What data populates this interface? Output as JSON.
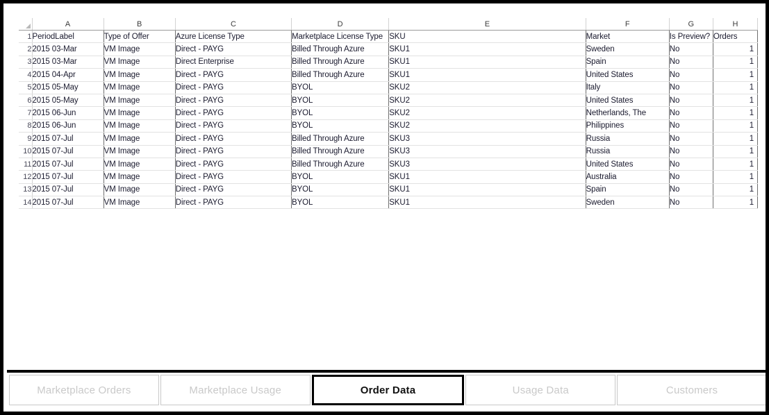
{
  "window": {
    "title": "Order Data"
  },
  "sheet": {
    "corner_label": "select-all",
    "column_letters": [
      "A",
      "B",
      "C",
      "D",
      "E",
      "F",
      "G",
      "H"
    ],
    "row_numbers": [
      "1",
      "2",
      "3",
      "4",
      "5",
      "6",
      "7",
      "8",
      "9",
      "10",
      "11",
      "12",
      "13",
      "14"
    ],
    "headers": {
      "a": "PeriodLabel",
      "b": "Type of Offer",
      "c": "Azure License Type",
      "d": "Marketplace License Type",
      "e": "SKU",
      "f": "Market",
      "g": "Is Preview?",
      "h": "Orders"
    },
    "rows": [
      {
        "num": "2",
        "period_label": "2015 03-Mar",
        "type_of_offer": "VM Image",
        "azure_license_type": "Direct - PAYG",
        "marketplace_license_type": "Billed Through Azure",
        "sku": "SKU1",
        "market": "Sweden",
        "is_preview": "No",
        "orders": "1"
      },
      {
        "num": "3",
        "period_label": "2015 03-Mar",
        "type_of_offer": "VM Image",
        "azure_license_type": "Direct Enterprise",
        "marketplace_license_type": "Billed Through Azure",
        "sku": "SKU1",
        "market": "Spain",
        "is_preview": "No",
        "orders": "1"
      },
      {
        "num": "4",
        "period_label": "2015 04-Apr",
        "type_of_offer": "VM Image",
        "azure_license_type": "Direct - PAYG",
        "marketplace_license_type": "Billed Through Azure",
        "sku": "SKU1",
        "market": "United States",
        "is_preview": "No",
        "orders": "1"
      },
      {
        "num": "5",
        "period_label": "2015 05-May",
        "type_of_offer": "VM Image",
        "azure_license_type": "Direct - PAYG",
        "marketplace_license_type": "BYOL",
        "sku": "SKU2",
        "market": "Italy",
        "is_preview": "No",
        "orders": "1"
      },
      {
        "num": "6",
        "period_label": "2015 05-May",
        "type_of_offer": "VM Image",
        "azure_license_type": "Direct - PAYG",
        "marketplace_license_type": "BYOL",
        "sku": "SKU2",
        "market": "United States",
        "is_preview": "No",
        "orders": "1"
      },
      {
        "num": "7",
        "period_label": "2015 06-Jun",
        "type_of_offer": "VM Image",
        "azure_license_type": "Direct - PAYG",
        "marketplace_license_type": "BYOL",
        "sku": "SKU2",
        "market": "Netherlands, The",
        "is_preview": "No",
        "orders": "1"
      },
      {
        "num": "8",
        "period_label": "2015 06-Jun",
        "type_of_offer": "VM Image",
        "azure_license_type": "Direct - PAYG",
        "marketplace_license_type": "BYOL",
        "sku": "SKU2",
        "market": "Philippines",
        "is_preview": "No",
        "orders": "1"
      },
      {
        "num": "9",
        "period_label": "2015 07-Jul",
        "type_of_offer": "VM Image",
        "azure_license_type": "Direct - PAYG",
        "marketplace_license_type": "Billed Through Azure",
        "sku": "SKU3",
        "market": "Russia",
        "is_preview": "No",
        "orders": "1"
      },
      {
        "num": "10",
        "period_label": "2015 07-Jul",
        "type_of_offer": "VM Image",
        "azure_license_type": "Direct - PAYG",
        "marketplace_license_type": "Billed Through Azure",
        "sku": "SKU3",
        "market": "Russia",
        "is_preview": "No",
        "orders": "1"
      },
      {
        "num": "11",
        "period_label": "2015 07-Jul",
        "type_of_offer": "VM Image",
        "azure_license_type": "Direct - PAYG",
        "marketplace_license_type": "Billed Through Azure",
        "sku": "SKU3",
        "market": "United States",
        "is_preview": "No",
        "orders": "1"
      },
      {
        "num": "12",
        "period_label": "2015 07-Jul",
        "type_of_offer": "VM Image",
        "azure_license_type": "Direct - PAYG",
        "marketplace_license_type": "BYOL",
        "sku": "SKU1",
        "market": "Australia",
        "is_preview": "No",
        "orders": "1"
      },
      {
        "num": "13",
        "period_label": "2015 07-Jul",
        "type_of_offer": "VM Image",
        "azure_license_type": "Direct - PAYG",
        "marketplace_license_type": "BYOL",
        "sku": "SKU1",
        "market": "Spain",
        "is_preview": "No",
        "orders": "1"
      },
      {
        "num": "14",
        "period_label": "2015 07-Jul",
        "type_of_offer": "VM Image",
        "azure_license_type": "Direct - PAYG",
        "marketplace_license_type": "BYOL",
        "sku": "SKU1",
        "market": "Sweden",
        "is_preview": "No",
        "orders": "1"
      }
    ]
  },
  "tabs": [
    {
      "label": "Marketplace Orders",
      "active": false
    },
    {
      "label": "Marketplace Usage",
      "active": false
    },
    {
      "label": "Order Data",
      "active": true
    },
    {
      "label": "Usage Data",
      "active": false
    },
    {
      "label": "Customers",
      "active": false
    }
  ],
  "colors": {
    "text": "#1a1a2e",
    "grid_line": "#e2e2e2",
    "column_separator": "#6f6f6f",
    "inactive_tab_text": "#c9c9c9",
    "active_tab_border": "#000000",
    "frame": "#000000"
  }
}
